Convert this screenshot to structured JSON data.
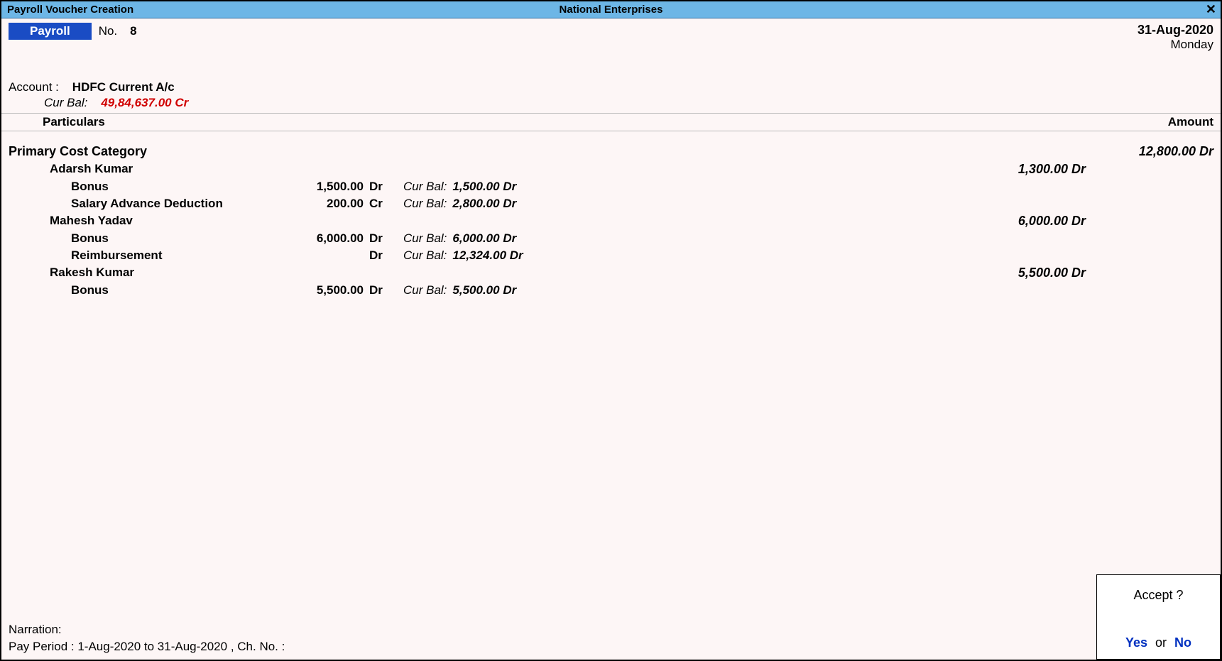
{
  "titlebar": {
    "left": "Payroll Voucher Creation",
    "center": "National Enterprises"
  },
  "voucher": {
    "type": "Payroll",
    "no_label": "No.",
    "no_value": "8",
    "date": "31-Aug-2020",
    "day": "Monday"
  },
  "account": {
    "label": "Account :",
    "name": "HDFC Current A/c",
    "curbal_label": "Cur Bal:",
    "curbal_value": "49,84,637.00 Cr"
  },
  "columns": {
    "particulars": "Particulars",
    "amount": "Amount"
  },
  "category": {
    "name": "Primary Cost Category",
    "total": "12,800.00 Dr"
  },
  "employees": [
    {
      "name": "Adarsh Kumar",
      "amount": "1,300.00 Dr",
      "payheads": [
        {
          "name": "Bonus",
          "amount": "1,500.00",
          "drcr": "Dr",
          "curbal_label": "Cur Bal:",
          "curbal": "1,500.00 Dr"
        },
        {
          "name": "Salary Advance Deduction",
          "amount": "200.00",
          "drcr": "Cr",
          "curbal_label": "Cur Bal:",
          "curbal": "2,800.00 Dr"
        }
      ]
    },
    {
      "name": "Mahesh Yadav",
      "amount": "6,000.00 Dr",
      "payheads": [
        {
          "name": "Bonus",
          "amount": "6,000.00",
          "drcr": "Dr",
          "curbal_label": "Cur Bal:",
          "curbal": "6,000.00 Dr"
        },
        {
          "name": "Reimbursement",
          "amount": "",
          "drcr": "Dr",
          "curbal_label": "Cur Bal:",
          "curbal": "12,324.00 Dr"
        }
      ]
    },
    {
      "name": "Rakesh Kumar",
      "amount": "5,500.00 Dr",
      "payheads": [
        {
          "name": "Bonus",
          "amount": "5,500.00",
          "drcr": "Dr",
          "curbal_label": "Cur Bal:",
          "curbal": "5,500.00 Dr"
        }
      ]
    }
  ],
  "narration": {
    "label": "Narration:",
    "payperiod": "Pay Period : 1-Aug-2020 to 31-Aug-2020 , Ch. No. :"
  },
  "accept": {
    "title": "Accept ?",
    "yes": "Yes",
    "or": "or",
    "no": "No"
  }
}
